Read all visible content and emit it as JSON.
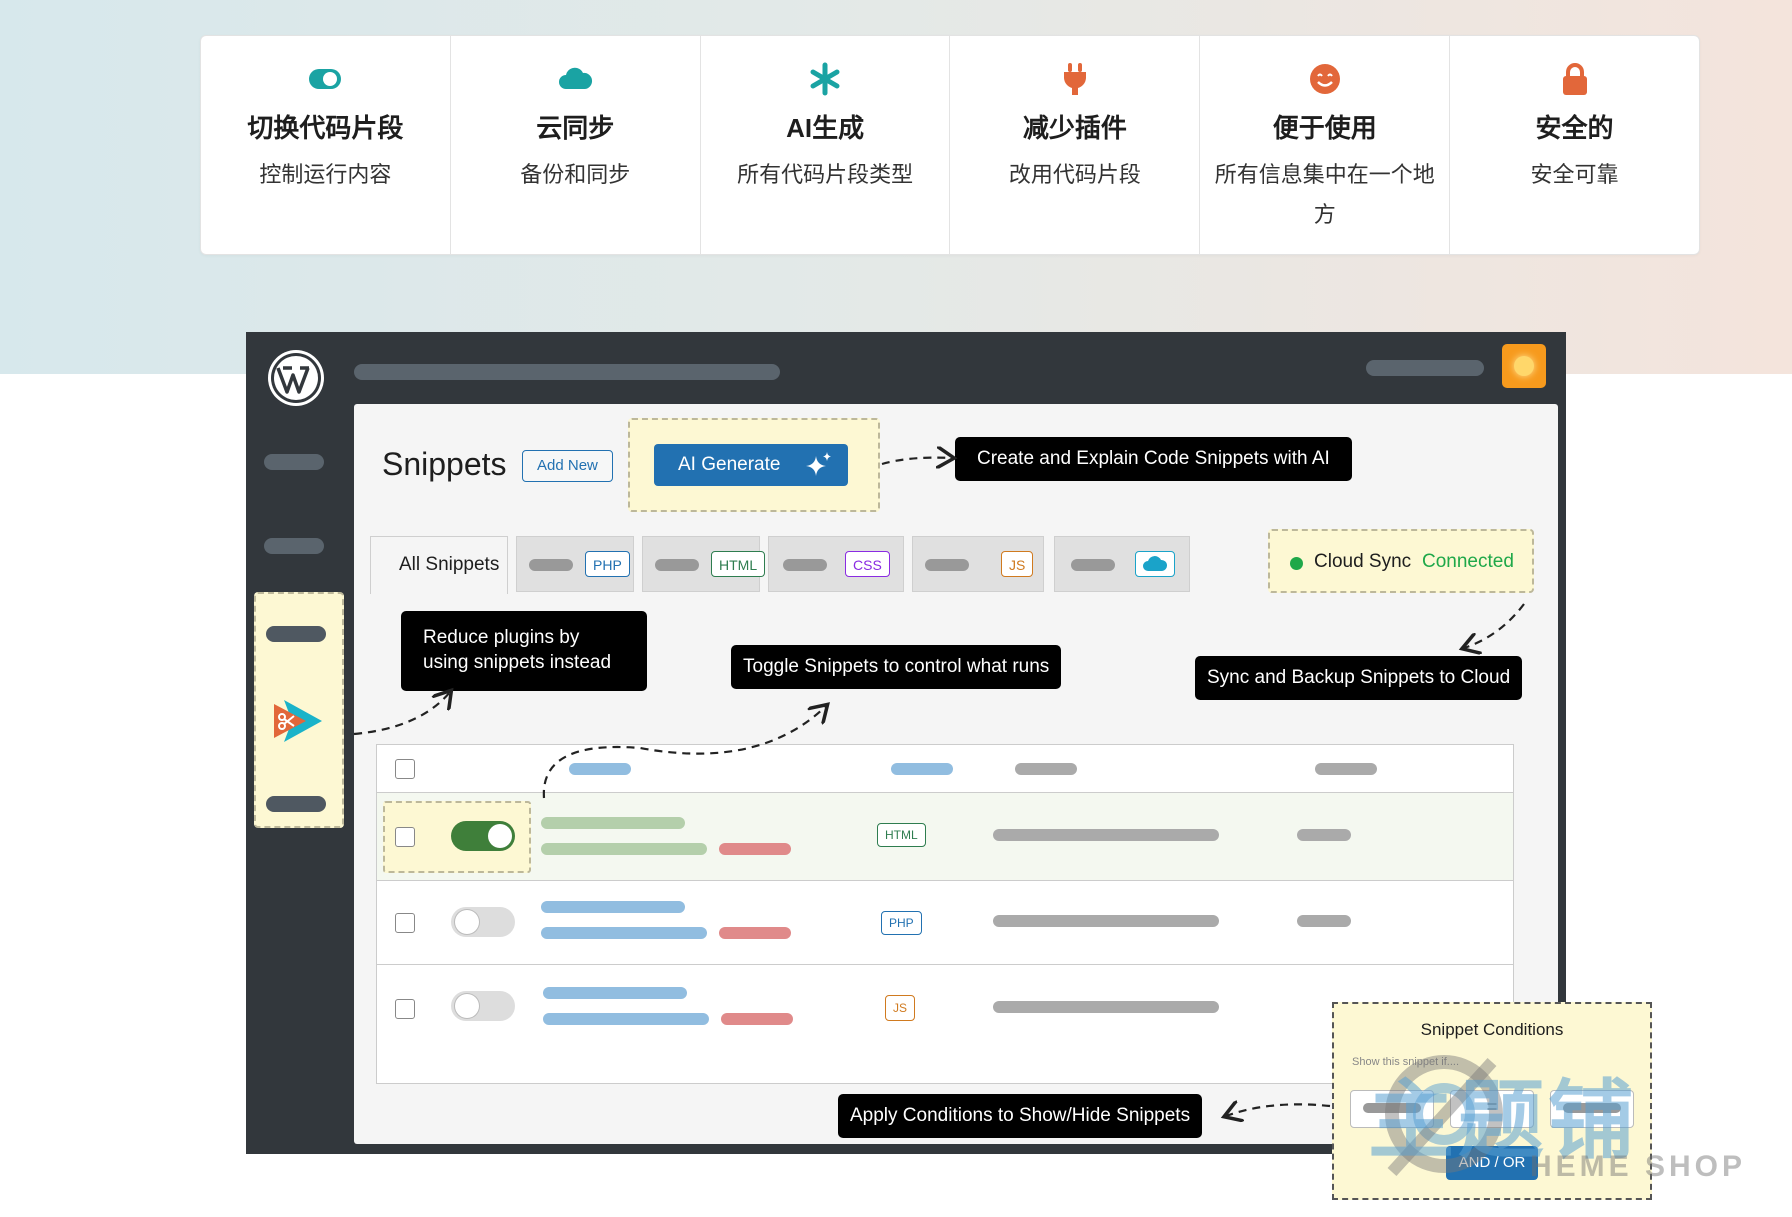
{
  "features": [
    {
      "icon": "toggle-icon",
      "color": "#1aa3a3",
      "title": "切换代码片段",
      "subtitle": "控制运行内容"
    },
    {
      "icon": "cloud-icon",
      "color": "#1aa3a3",
      "title": "云同步",
      "subtitle": "备份和同步"
    },
    {
      "icon": "asterisk-icon",
      "color": "#1aa3a3",
      "title": "AI生成",
      "subtitle": "所有代码片段类型"
    },
    {
      "icon": "plug-icon",
      "color": "#e2673a",
      "title": "减少插件",
      "subtitle": "改用代码片段"
    },
    {
      "icon": "smile-icon",
      "color": "#e2673a",
      "title": "便于使用",
      "subtitle": "所有信息集中在一个地方"
    },
    {
      "icon": "lock-icon",
      "color": "#e2673a",
      "title": "安全的",
      "subtitle": "安全可靠"
    }
  ],
  "admin": {
    "page_title": "Snippets",
    "add_new_label": "Add New",
    "ai_generate_label": "AI Generate",
    "tabs": {
      "all_label": "All Snippets",
      "types": [
        {
          "badge": "PHP",
          "color": "#2271b1"
        },
        {
          "badge": "HTML",
          "color": "#2e7d4f"
        },
        {
          "badge": "CSS",
          "color": "#8a2be2"
        },
        {
          "badge": "JS",
          "color": "#d07a1f"
        },
        {
          "badge": "cloud-icon",
          "color": "#1aa3c9"
        }
      ]
    },
    "cloud_sync": {
      "label": "Cloud Sync",
      "status": "Connected",
      "status_color": "#1fa849"
    },
    "rows": [
      {
        "toggle_on": true,
        "type": "HTML",
        "type_color": "#2e7d4f"
      },
      {
        "toggle_on": false,
        "type": "PHP",
        "type_color": "#2271b1"
      },
      {
        "toggle_on": false,
        "type": "JS",
        "type_color": "#d07a1f"
      }
    ]
  },
  "callouts": {
    "ai": "Create and Explain Code Snippets with AI",
    "reduce_line1": "Reduce plugins by",
    "reduce_line2": "using snippets instead",
    "toggle": "Toggle Snippets to control what runs",
    "sync": "Sync and Backup Snippets to Cloud",
    "conditions": "Apply Conditions to Show/Hide Snippets"
  },
  "conditions_panel": {
    "title": "Snippet Conditions",
    "subtitle": "Show this snippet if....",
    "operator": "=",
    "and_or_label": "AND / OR"
  },
  "watermark": {
    "text_cn": "主题铺",
    "text_en": "HEME SHOP"
  }
}
